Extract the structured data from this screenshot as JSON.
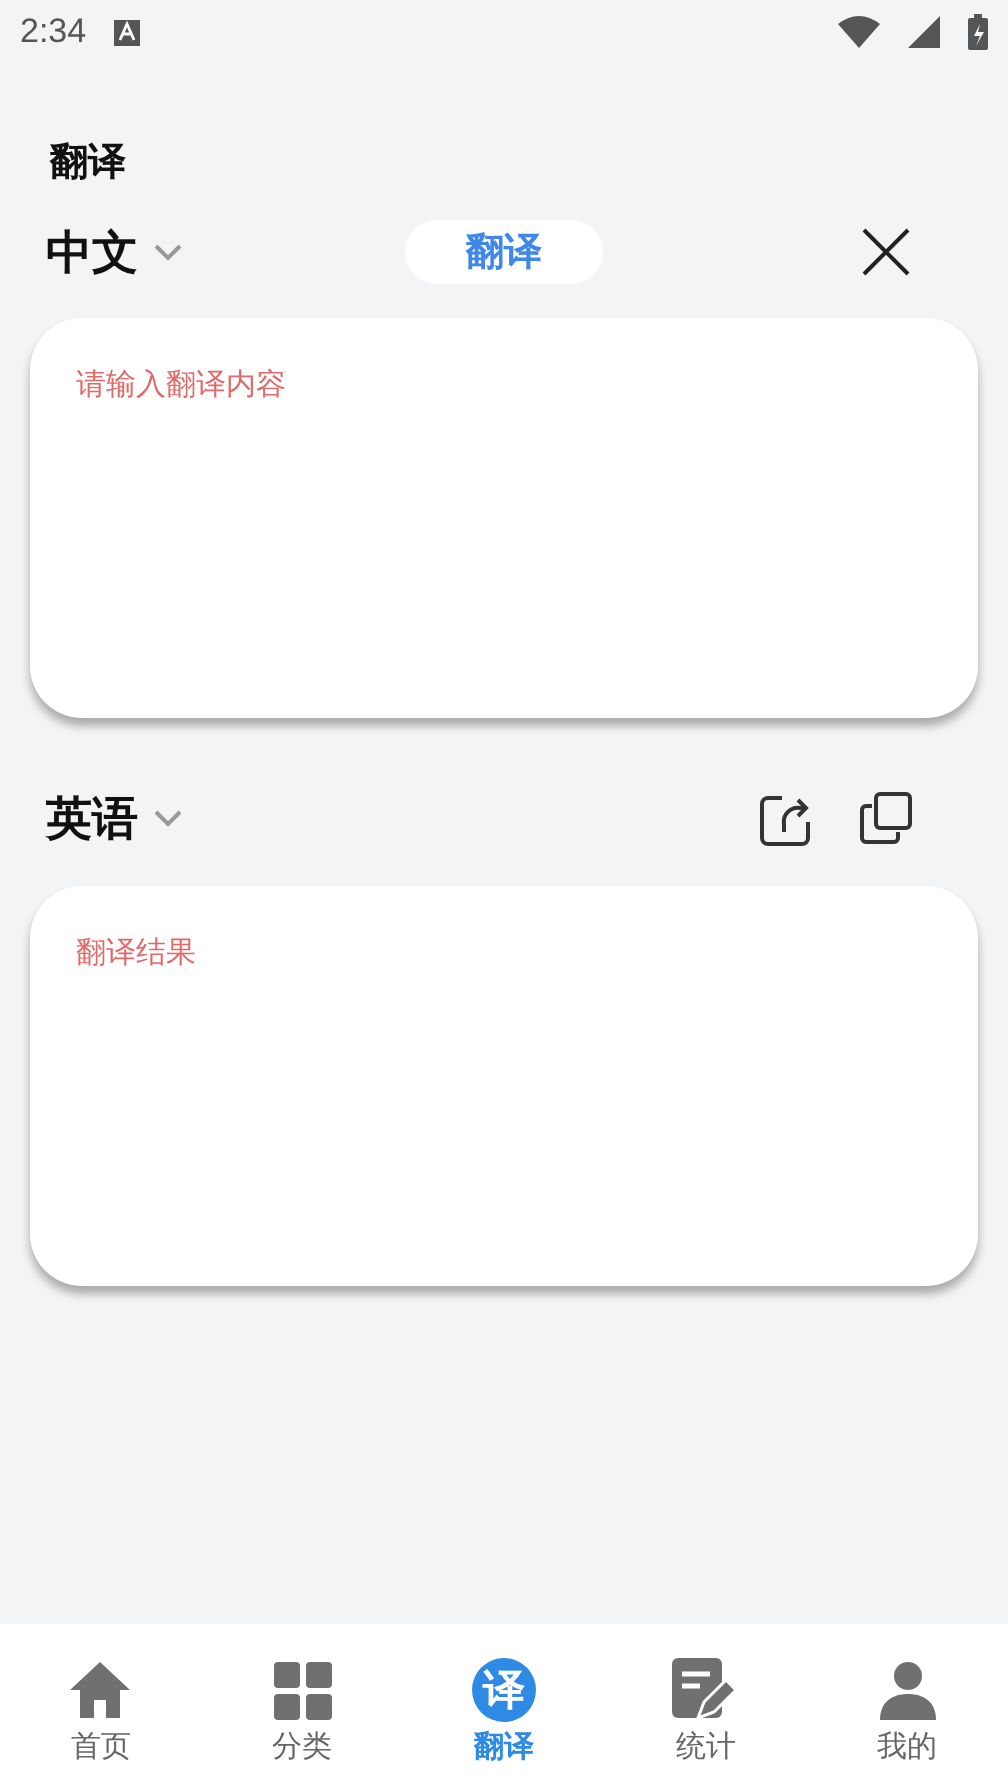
{
  "status_bar": {
    "time": "2:34"
  },
  "title": "翻译",
  "source": {
    "language": "中文",
    "action": "翻译",
    "input": {
      "placeholder": "请输入翻译内容"
    }
  },
  "target": {
    "language": "英语",
    "output": {
      "placeholder": "翻译结果"
    }
  },
  "bottom_nav": [
    {
      "label": "首页",
      "kind": "home",
      "selected": false
    },
    {
      "label": "分类",
      "kind": "grid",
      "selected": false
    },
    {
      "label": "翻译",
      "kind": "glyph",
      "icon_text": "译",
      "selected": true
    },
    {
      "label": "统计",
      "kind": "note",
      "selected": false
    },
    {
      "label": "我的",
      "kind": "person",
      "selected": false
    }
  ]
}
